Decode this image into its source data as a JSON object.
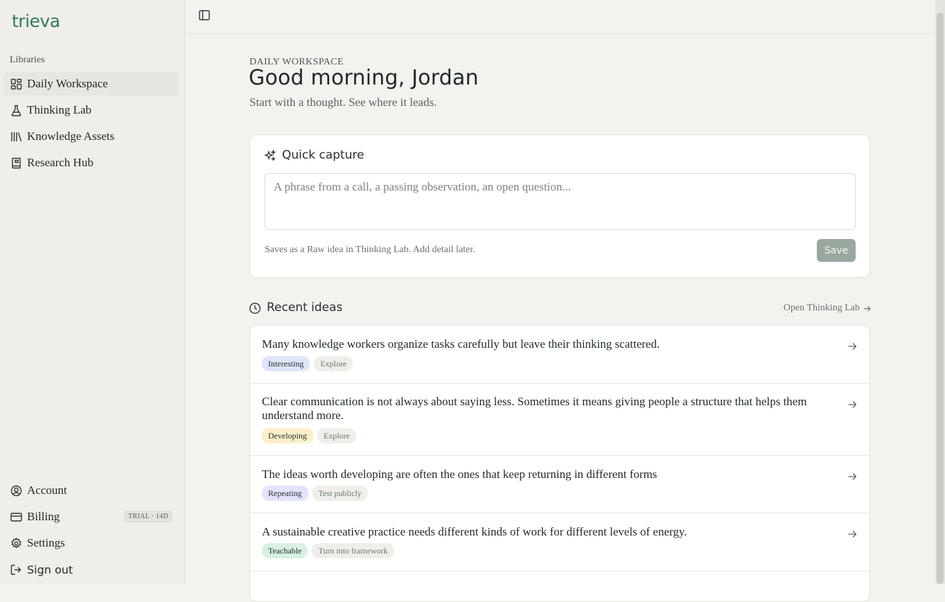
{
  "app": {
    "logo": "trieva"
  },
  "sidebar": {
    "section_label": "Libraries",
    "nav": [
      {
        "label": "Daily Workspace",
        "icon": "grid-icon",
        "active": true
      },
      {
        "label": "Thinking Lab",
        "icon": "flask-icon"
      },
      {
        "label": "Knowledge Assets",
        "icon": "library-icon"
      },
      {
        "label": "Research Hub",
        "icon": "book-icon"
      }
    ],
    "footer": [
      {
        "label": "Account",
        "icon": "user-circle-icon"
      },
      {
        "label": "Billing",
        "icon": "credit-card-icon",
        "badge": "TRIAL · 14D"
      },
      {
        "label": "Settings",
        "icon": "gear-icon"
      },
      {
        "label": "Sign out",
        "icon": "sign-out-icon"
      }
    ]
  },
  "header": {
    "eyebrow": "DAILY WORKSPACE",
    "greeting": "Good morning, Jordan",
    "subtitle": "Start with a thought. See where it leads."
  },
  "capture": {
    "title": "Quick capture",
    "placeholder": "A phrase from a call, a passing observation, an open question...",
    "value": "",
    "hint": "Saves as a Raw idea in Thinking Lab. Add detail later.",
    "save_label": "Save"
  },
  "recent": {
    "title": "Recent ideas",
    "link_label": "Open Thinking Lab",
    "ideas": [
      {
        "text": "Many knowledge workers organize tasks carefully but leave their thinking scattered.",
        "status": "Interesting",
        "status_color": "#dde6fb",
        "action": "Explore"
      },
      {
        "text": "Clear communication is not always about saying less. Sometimes it means giving people a structure that helps them understand more.",
        "status": "Developing",
        "status_color": "#fbefc8",
        "action": "Explore"
      },
      {
        "text": "The ideas worth developing are often the ones that keep returning in different forms",
        "status": "Repeating",
        "status_color": "#e4e3fb",
        "action": "Test publicly"
      },
      {
        "text": "A sustainable creative practice needs different kinds of work for different levels of energy.",
        "status": "Teachable",
        "status_color": "#d8f1e1",
        "action": "Turn into framework"
      }
    ]
  },
  "colors": {
    "accent": "#2f7a5a",
    "save_button": "#9aa79e"
  }
}
